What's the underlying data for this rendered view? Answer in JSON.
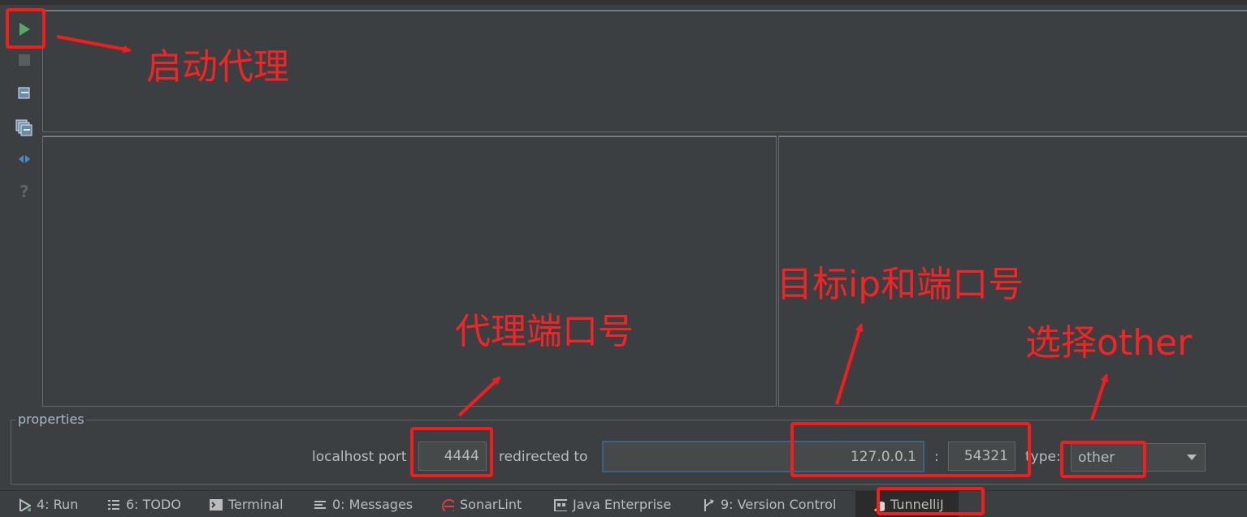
{
  "window": {
    "toolbar": {
      "icons": [
        "run-icon",
        "stop-icon",
        "clear-icon",
        "clear-all-icon",
        "wrap-icon",
        "help-icon"
      ],
      "help_glyph": "?"
    }
  },
  "properties": {
    "title": "properties",
    "localhost_port_label": "localhost port",
    "localhost_port_value": "4444",
    "redirected_to_label": "redirected to",
    "target_host_value": "127.0.0.1",
    "colon": ":",
    "target_port_value": "54321",
    "type_label": "type:",
    "type_value": "other"
  },
  "bottom_tabs": [
    {
      "label": "4: Run",
      "icon": "run-tab-icon"
    },
    {
      "label": "6: TODO",
      "icon": "list-icon"
    },
    {
      "label": "Terminal",
      "icon": "terminal-icon"
    },
    {
      "label": "0: Messages",
      "icon": "messages-icon"
    },
    {
      "label": "SonarLint",
      "icon": "sonarlint-icon"
    },
    {
      "label": "Java Enterprise",
      "icon": "java-enterprise-icon"
    },
    {
      "label": "9: Version Control",
      "icon": "version-control-icon"
    },
    {
      "label": "TunnelliJ",
      "icon": "tunnellij-icon"
    }
  ],
  "annotations": {
    "start_proxy": "启动代理",
    "proxy_port": "代理端口号",
    "target_ip_port": "目标ip和端口号",
    "choose_other": "选择other"
  },
  "colors": {
    "background": "#3c3f41",
    "annotation": "#f31d1d",
    "run_green": "#59a869"
  }
}
